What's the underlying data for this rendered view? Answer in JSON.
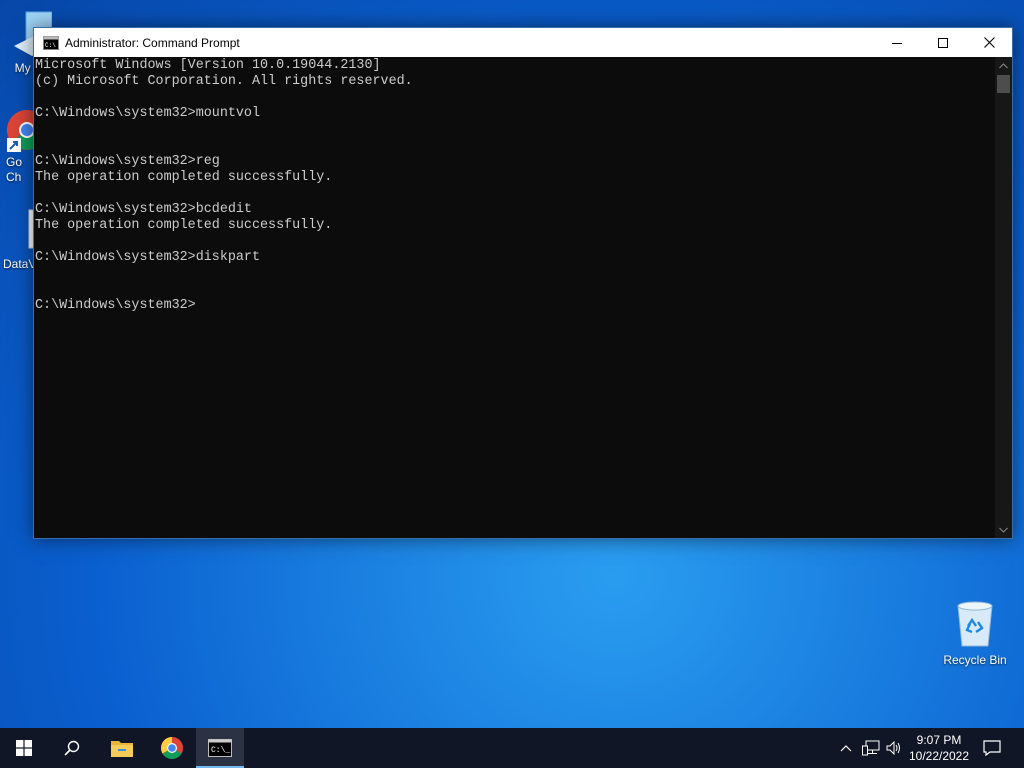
{
  "desktop": {
    "icons": [
      {
        "label": "My Co",
        "icon": "computer-icon"
      },
      {
        "label": "Go\nCh",
        "icon": "chrome-icon"
      },
      {
        "label": "DataV",
        "icon": "file-icon"
      },
      {
        "label": "Recycle Bin",
        "icon": "recycle-bin-icon"
      }
    ]
  },
  "window": {
    "title": "Administrator: Command Prompt",
    "lines": [
      "Microsoft Windows [Version 10.0.19044.2130]",
      "(c) Microsoft Corporation. All rights reserved.",
      "",
      "C:\\Windows\\system32>mountvol",
      "",
      "",
      "C:\\Windows\\system32>reg",
      "The operation completed successfully.",
      "",
      "C:\\Windows\\system32>bcdedit",
      "The operation completed successfully.",
      "",
      "C:\\Windows\\system32>diskpart",
      "",
      "",
      "C:\\Windows\\system32>"
    ]
  },
  "taskbar": {
    "apps": [
      "start-icon",
      "search-icon",
      "file-explorer-icon",
      "chrome-icon",
      "command-prompt-icon"
    ],
    "clock": {
      "time": "9:07 PM",
      "date": "10/22/2022"
    }
  },
  "colors": {
    "console_bg": "#0c0c0c",
    "console_fg": "#cccccc",
    "taskbar": "#101626"
  }
}
